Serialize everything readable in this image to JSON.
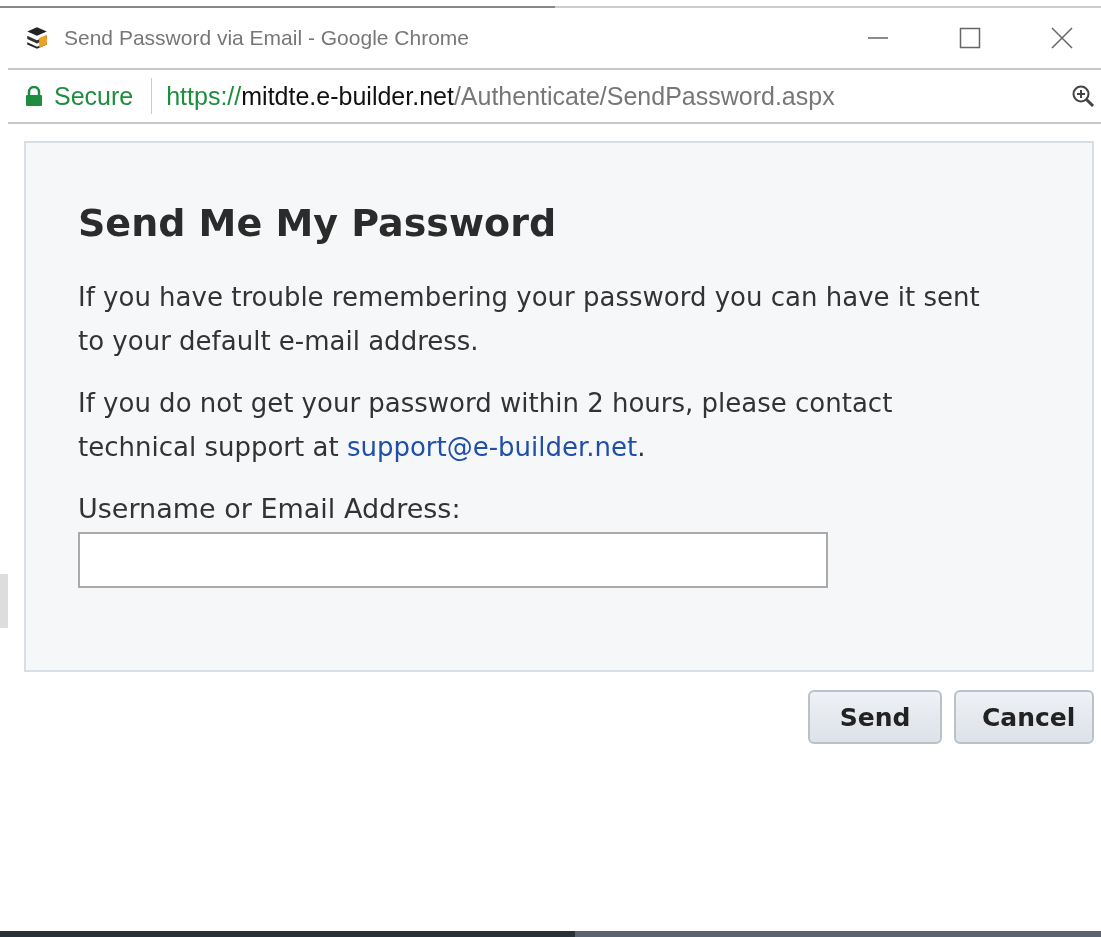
{
  "window": {
    "title": "Send Password via Email - Google Chrome"
  },
  "address_bar": {
    "security": "Secure",
    "url_scheme": "https://",
    "url_host": "mitdte.e-builder.net",
    "url_path": "/Authenticate/SendPassword.aspx"
  },
  "dialog": {
    "heading": "Send Me My Password",
    "paragraphs": [
      {
        "text": "If you have trouble remembering your password you can have it sent to your default e-mail address."
      },
      {
        "text": "If you do not get your password within 2 hours, please contact technical support at ",
        "link": "support@e-builder.net",
        "text_after": "."
      }
    ],
    "field": {
      "label": "Username or Email Address:"
    },
    "buttons": [
      "Send",
      "Cancel"
    ]
  }
}
